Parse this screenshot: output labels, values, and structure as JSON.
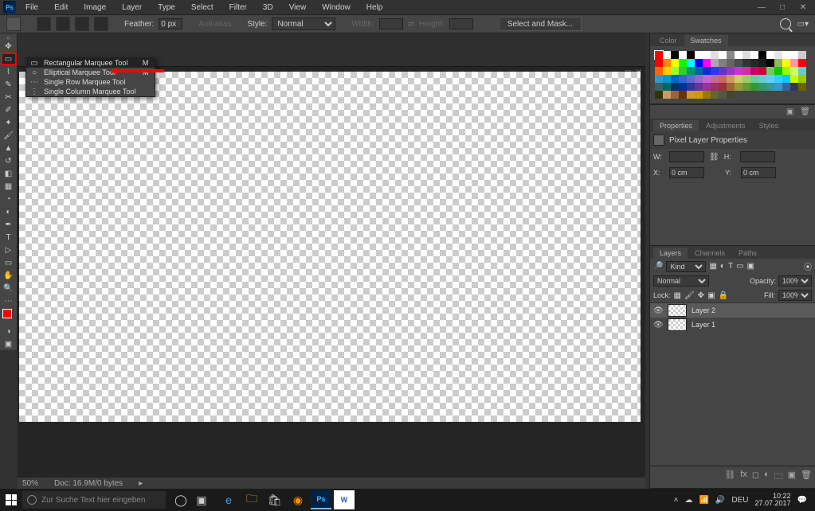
{
  "app": {
    "logo": "Ps"
  },
  "menubar": [
    "File",
    "Edit",
    "Image",
    "Layer",
    "Type",
    "Select",
    "Filter",
    "3D",
    "View",
    "Window",
    "Help"
  ],
  "window_controls": [
    "—",
    "□",
    "✕"
  ],
  "options": {
    "feather_label": "Feather:",
    "feather_value": "0 px",
    "antialias": "Anti-alias",
    "style_label": "Style:",
    "style_value": "Normal",
    "width_label": "Width:",
    "height_label": "Height:",
    "select_mask": "Select and Mask..."
  },
  "tool_flyout": [
    {
      "icon": "▭",
      "label": "Rectangular Marquee Tool",
      "key": "M",
      "active": true
    },
    {
      "icon": "○",
      "label": "Elliptical Marquee Tool",
      "key": "M",
      "active": false
    },
    {
      "icon": "⋯",
      "label": "Single Row Marquee Tool",
      "key": "",
      "active": false
    },
    {
      "icon": "⋮",
      "label": "Single Column Marquee Tool",
      "key": "",
      "active": false
    }
  ],
  "doc": {
    "zoom": "50%",
    "info": "Doc: 16.9M/0 bytes"
  },
  "panels": {
    "swatches_tabs": [
      "Color",
      "Swatches"
    ],
    "properties_tabs": [
      "Properties",
      "Adjustments",
      "Styles"
    ],
    "layers_tabs": [
      "Layers",
      "Channels",
      "Paths"
    ]
  },
  "swatch_colors": [
    "#ff0000",
    "#ffffff",
    "#000000",
    "#ffffff",
    "#000000",
    "#ffffff",
    "#ffffff",
    "#dddddd",
    "#ffffff",
    "#888888",
    "#ffffff",
    "#dddddd",
    "#ffffff",
    "#000000",
    "#ffffff",
    "#e6e6e6",
    "#ffffff",
    "#ffffff",
    "#cccccc",
    "#ff0000",
    "#ff8800",
    "#ffff00",
    "#00ff00",
    "#00ffff",
    "#0000ff",
    "#ff00ff",
    "#aaaaaa",
    "#808080",
    "#666666",
    "#4d4d4d",
    "#333333",
    "#262626",
    "#1a1a1a",
    "#000000",
    "#98b858",
    "#ffff00",
    "#ff9999",
    "#ff0000",
    "#ff6600",
    "#ffcc00",
    "#99ff33",
    "#33cc33",
    "#009966",
    "#006699",
    "#0033cc",
    "#3333ff",
    "#6633cc",
    "#9933cc",
    "#cc33cc",
    "#cc3399",
    "#cc0066",
    "#cc0033",
    "#66cc66",
    "#00cc00",
    "#99ff00",
    "#ccff66",
    "#66cccc",
    "#3399cc",
    "#0099cc",
    "#0066cc",
    "#3366cc",
    "#6666cc",
    "#9966cc",
    "#cc66cc",
    "#cc6699",
    "#cc6666",
    "#cc9966",
    "#cccc66",
    "#99cc66",
    "#66cc99",
    "#66cccc",
    "#66ccff",
    "#33ccff",
    "#00ccff",
    "#ccff00",
    "#99cc00",
    "#336666",
    "#006666",
    "#003366",
    "#003399",
    "#333399",
    "#663399",
    "#993399",
    "#993366",
    "#993333",
    "#996633",
    "#999933",
    "#669933",
    "#339933",
    "#339966",
    "#339999",
    "#3399cc",
    "#336699",
    "#333366",
    "#666600",
    "#333300",
    "#cc9966",
    "#996633",
    "#663300",
    "#cc9933",
    "#cc9900",
    "#997a00",
    "#666633",
    "#555544",
    "#444433"
  ],
  "properties": {
    "title": "Pixel Layer Properties",
    "w_label": "W:",
    "h_label": "H:",
    "w_value": "",
    "h_value": "",
    "x_label": "X:",
    "y_label": "Y:",
    "x_value": "0 cm",
    "y_value": "0 cm"
  },
  "layers": {
    "kind_label": "Kind",
    "blend_mode": "Normal",
    "opacity_label": "Opacity:",
    "opacity_value": "100%",
    "lock_label": "Lock:",
    "fill_label": "Fill:",
    "fill_value": "100%",
    "items": [
      {
        "name": "Layer 2",
        "visible": true,
        "selected": true
      },
      {
        "name": "Layer 1",
        "visible": true,
        "selected": false
      }
    ]
  },
  "taskbar": {
    "search_placeholder": "Zur Suche Text hier eingeben",
    "lang": "DEU",
    "time": "10:22",
    "date": "27.07.2017"
  }
}
